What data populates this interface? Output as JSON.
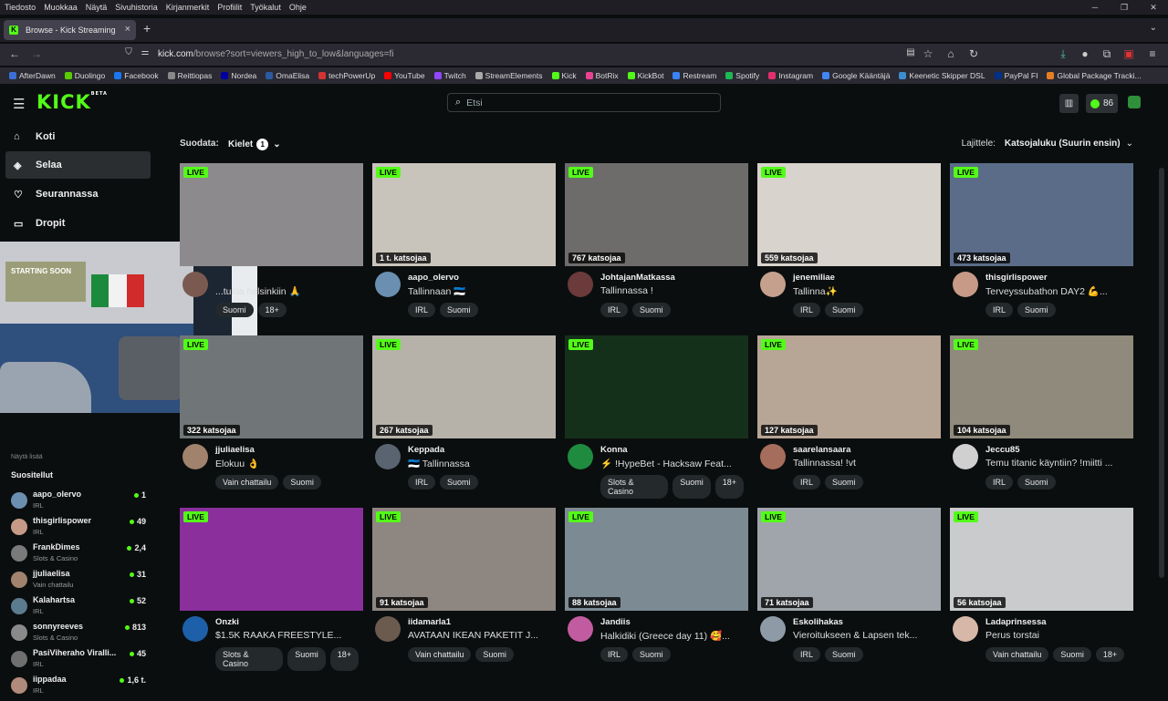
{
  "browser": {
    "menu": [
      "Tiedosto",
      "Muokkaa",
      "Näytä",
      "Sivuhistoria",
      "Kirjanmerkit",
      "Profiilit",
      "Työkalut",
      "Ohje"
    ],
    "tab_title": "Browse - Kick Streaming",
    "url_host": "kick.com",
    "url_path": "/browse?sort=viewers_high_to_low&languages=fi",
    "bookmarks": [
      {
        "label": "AfterDawn",
        "color": "#3b6fd6"
      },
      {
        "label": "Duolingo",
        "color": "#58cc02"
      },
      {
        "label": "Facebook",
        "color": "#1877f2"
      },
      {
        "label": "Reittiopas",
        "color": "#888888"
      },
      {
        "label": "Nordea",
        "color": "#0000a0"
      },
      {
        "label": "OmaElisa",
        "color": "#2c5aa0"
      },
      {
        "label": "techPowerUp",
        "color": "#d33333"
      },
      {
        "label": "YouTube",
        "color": "#ff0000"
      },
      {
        "label": "Twitch",
        "color": "#9146ff"
      },
      {
        "label": "StreamElements",
        "color": "#aaaaaa"
      },
      {
        "label": "Kick",
        "color": "#53fc18"
      },
      {
        "label": "BotRix",
        "color": "#e84393"
      },
      {
        "label": "KickBot",
        "color": "#53fc18"
      },
      {
        "label": "Restream",
        "color": "#3b82f6"
      },
      {
        "label": "Spotify",
        "color": "#1db954"
      },
      {
        "label": "Instagram",
        "color": "#e1306c"
      },
      {
        "label": "Google Kääntäjä",
        "color": "#4285f4"
      },
      {
        "label": "Keenetic Skipper DSL",
        "color": "#3b8ed0"
      },
      {
        "label": "PayPal FI",
        "color": "#003087"
      },
      {
        "label": "Global Package Tracki...",
        "color": "#e67e22"
      }
    ]
  },
  "kick": {
    "logo": "KICK",
    "beta": "BETA",
    "search_placeholder": "Etsi",
    "points": "86",
    "accent": "#53fc18",
    "nav": [
      {
        "label": "Koti",
        "icon": "home-icon"
      },
      {
        "label": "Selaa",
        "icon": "compass-icon"
      },
      {
        "label": "Seurannassa",
        "icon": "heart-icon"
      },
      {
        "label": "Dropit",
        "icon": "gift-icon"
      }
    ],
    "show_less": "Näytä lisää",
    "recommended_title": "Suositellut",
    "recommended": [
      {
        "name": "aapo_olervo",
        "cat": "IRL",
        "viewers": "1",
        "color": "#6a8fb0"
      },
      {
        "name": "thisgirlispower",
        "cat": "IRL",
        "viewers": "49",
        "color": "#c69a86"
      },
      {
        "name": "FrankDimes",
        "cat": "Slots & Casino",
        "viewers": "2,4",
        "color": "#7a7a7a"
      },
      {
        "name": "jjuliaelisa",
        "cat": "Vain chattailu",
        "viewers": "31",
        "color": "#a0826d"
      },
      {
        "name": "Kalahartsa",
        "cat": "IRL",
        "viewers": "52",
        "color": "#5b7b8f"
      },
      {
        "name": "sonnyreeves",
        "cat": "Slots & Casino",
        "viewers": "813",
        "color": "#8a8a8a"
      },
      {
        "name": "PasiViheraho Viralli...",
        "cat": "IRL",
        "viewers": "45",
        "color": "#6f6f6f"
      },
      {
        "name": "iippadaa",
        "cat": "IRL",
        "viewers": "1,6 t.",
        "color": "#b08a7a"
      }
    ],
    "webcam_poster": "STARTING SOON",
    "filter_label": "Suodata:",
    "filter_button": "Kielet",
    "filter_count": "1",
    "sort_label": "Lajittele:",
    "sort_value": "Katsojaluku (Suurin ensin)",
    "streams": [
      {
        "name": "",
        "title": "...tuloa helsinkiin 🙏",
        "viewers": "",
        "tags": [
          "Suomi",
          "18+"
        ],
        "thumb": "#8c8a8c",
        "avatar": "#7a5a50"
      },
      {
        "name": "aapo_olervo",
        "title": "Tallinnaan 🇪🇪",
        "viewers": "1 t. katsojaa",
        "tags": [
          "IRL",
          "Suomi"
        ],
        "thumb": "#c9c4bb",
        "avatar": "#6a8fb0"
      },
      {
        "name": "JohtajanMatkassa",
        "title": "Tallinnassa !",
        "viewers": "767 katsojaa",
        "tags": [
          "IRL",
          "Suomi"
        ],
        "thumb": "#6d6c6a",
        "avatar": "#6b3a3a"
      },
      {
        "name": "jenemiliae",
        "title": "Tallinna✨",
        "viewers": "559 katsojaa",
        "tags": [
          "IRL",
          "Suomi"
        ],
        "thumb": "#d8d3cc",
        "avatar": "#c5a08c"
      },
      {
        "name": "thisgirlispower",
        "title": "Terveyssubathon DAY2 💪...",
        "viewers": "473 katsojaa",
        "tags": [
          "IRL",
          "Suomi"
        ],
        "thumb": "#5a6c88",
        "avatar": "#c69a86"
      },
      {
        "name": "jjuliaelisa",
        "title": "Elokuu 👌",
        "viewers": "322 katsojaa",
        "tags": [
          "Vain chattailu",
          "Suomi"
        ],
        "thumb": "#707678",
        "avatar": "#a0826d"
      },
      {
        "name": "Keppada",
        "title": "🇪🇪 Tallinnassa",
        "viewers": "267 katsojaa",
        "tags": [
          "IRL",
          "Suomi"
        ],
        "thumb": "#b6b2aa",
        "avatar": "#5a6470"
      },
      {
        "name": "Konna",
        "title": "⚡ !HypeBet - Hacksaw Feat...",
        "viewers": "",
        "tags": [
          "Slots & Casino",
          "Suomi",
          "18+"
        ],
        "thumb": "#15301a",
        "avatar": "#1f8b3f"
      },
      {
        "name": "saarelansaara",
        "title": "Tallinnassa! !vt",
        "viewers": "127 katsojaa",
        "tags": [
          "IRL",
          "Suomi"
        ],
        "thumb": "#b7a596",
        "avatar": "#a56d5b"
      },
      {
        "name": "Jeccu85",
        "title": "Temu titanic käyntiin? !miitti ...",
        "viewers": "104 katsojaa",
        "tags": [
          "IRL",
          "Suomi"
        ],
        "thumb": "#8f8a7c",
        "avatar": "#d0d0d0"
      },
      {
        "name": "Onzki",
        "title": "$1.5K RAAKA FREESTYLE...",
        "viewers": "",
        "tags": [
          "Slots & Casino",
          "Suomi",
          "18+"
        ],
        "thumb": "#8a2f9c",
        "avatar": "#1d5fa8"
      },
      {
        "name": "iidamarla1",
        "title": "AVATAAN IKEAN PAKETIT J...",
        "viewers": "91 katsojaa",
        "tags": [
          "Vain chattailu",
          "Suomi"
        ],
        "thumb": "#8e8681",
        "avatar": "#6b5a4e"
      },
      {
        "name": "Jandiis",
        "title": "Halkidiki (Greece day 11) 🥰...",
        "viewers": "88 katsojaa",
        "tags": [
          "IRL",
          "Suomi"
        ],
        "thumb": "#7c8a93",
        "avatar": "#c25ca0"
      },
      {
        "name": "Eskolihakas",
        "title": "Vieroitukseen & Lapsen tek...",
        "viewers": "71 katsojaa",
        "tags": [
          "IRL",
          "Suomi"
        ],
        "thumb": "#9fa5ab",
        "avatar": "#8e9aa6"
      },
      {
        "name": "Ladaprinsessa",
        "title": "Perus torstai",
        "viewers": "56 katsojaa",
        "tags": [
          "Vain chattailu",
          "Suomi",
          "18+"
        ],
        "thumb": "#c9cbcd",
        "avatar": "#d6b7a8"
      }
    ]
  }
}
